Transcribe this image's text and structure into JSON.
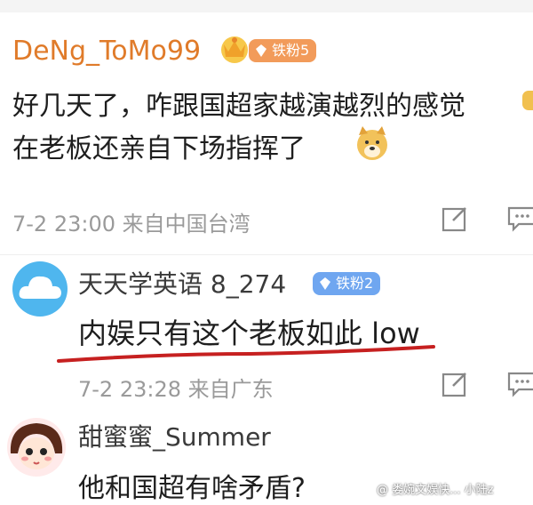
{
  "comment": {
    "username": "DeNg_ToMo99",
    "fan_badge": "铁粉5",
    "text_line1": "好几天了，咋跟国超家越演越烈的感觉",
    "text_line2": "在老板还亲自下场指挥了",
    "meta": "7-2 23:00 来自中国台湾"
  },
  "replies": [
    {
      "username": "天天学英语 8_274",
      "fan_badge": "铁粉2",
      "text": "内娱只有这个老板如此 low",
      "meta": "7-2 23:28 来自广东"
    },
    {
      "username": "甜蜜蜜_Summer",
      "text": "他和国超有啥矛盾?"
    }
  ],
  "watermark": "@ 娄婉文娱快... 小陆z",
  "icons": [
    "crown-icon",
    "diamond-icon",
    "doge-emoji",
    "edit-icon",
    "comment-icon"
  ],
  "colors": {
    "username_accent": "#e07b2a",
    "badge_orange": "#f29b5a",
    "badge_blue": "#6fa6f0",
    "underline_red": "#c62020",
    "meta_gray": "#9a9a9a"
  }
}
